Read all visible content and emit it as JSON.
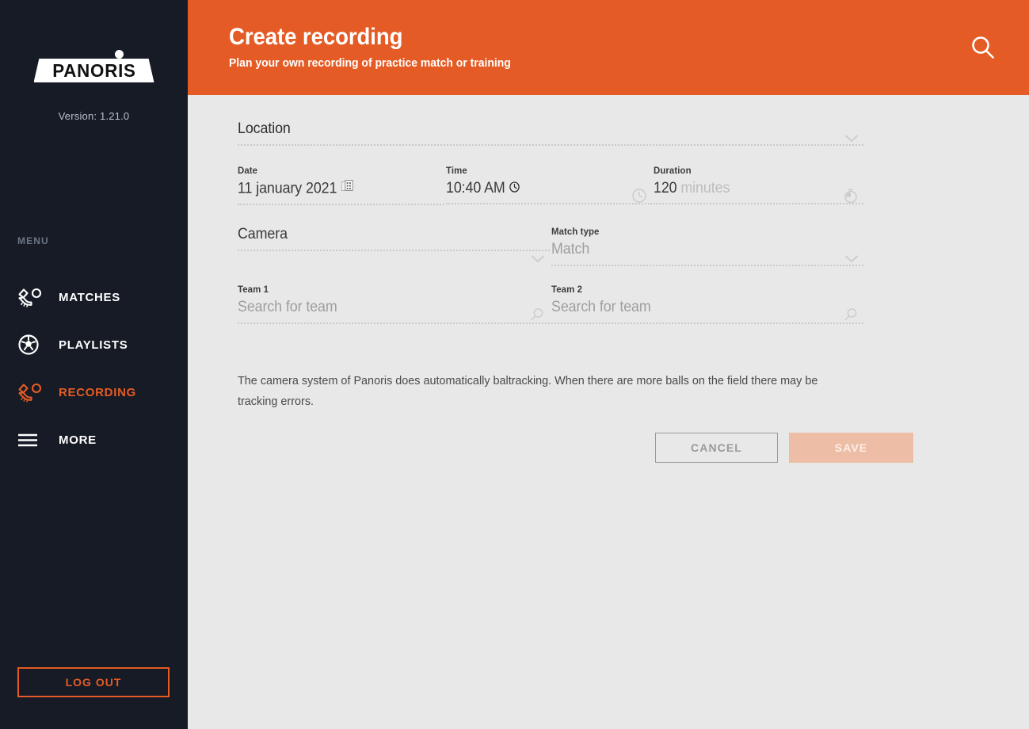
{
  "theme": {
    "accent": "#E55B25",
    "sidebar_bg": "#161B26",
    "main_bg": "#E8E8E8",
    "save_disabled_bg": "#EEBDA5"
  },
  "sidebar": {
    "logo_text": "PANORIS",
    "logo_icon": "panoris-logo",
    "version": "Version: 1.21.0",
    "menu_label": "MENU",
    "items": [
      {
        "label": "MATCHES",
        "icon": "boot-ball-icon",
        "active": false
      },
      {
        "label": "PLAYLISTS",
        "icon": "soccer-ball-icon",
        "active": false
      },
      {
        "label": "RECORDING",
        "icon": "boot-ball-icon",
        "active": true
      },
      {
        "label": "MORE",
        "icon": "hamburger-icon",
        "active": false
      }
    ],
    "logout_label": "LOG OUT"
  },
  "header": {
    "title": "Create recording",
    "subtitle": "Plan your own recording of practice match or training",
    "search_icon": "search-icon"
  },
  "form": {
    "location": {
      "label": "Location",
      "value": "Location",
      "icon": "chevron-down-icon"
    },
    "date": {
      "label": "Date",
      "value": "11 january 2021",
      "icon": "calendar-icon"
    },
    "time": {
      "label": "Time",
      "value": "10:40 AM",
      "inline_icon": "clock-icon",
      "end_icon": "clock-outline-icon"
    },
    "duration": {
      "label": "Duration",
      "value": "120",
      "unit": "minutes",
      "end_icon": "stopwatch-icon"
    },
    "camera": {
      "label": "Camera",
      "value": "Camera",
      "icon": "chevron-down-icon"
    },
    "match_type": {
      "label": "Match type",
      "value": "Match",
      "icon": "chevron-down-icon",
      "options": [
        "Match"
      ]
    },
    "team1": {
      "label": "Team 1",
      "placeholder": "Search for team",
      "value": "",
      "icon": "search-icon"
    },
    "team2": {
      "label": "Team 2",
      "placeholder": "Search for team",
      "value": "",
      "icon": "search-icon"
    },
    "note": "The camera system of Panoris does automatically baltracking. When there are more balls on the field there may be tracking errors.",
    "cancel_label": "CANCEL",
    "save_label": "SAVE"
  }
}
